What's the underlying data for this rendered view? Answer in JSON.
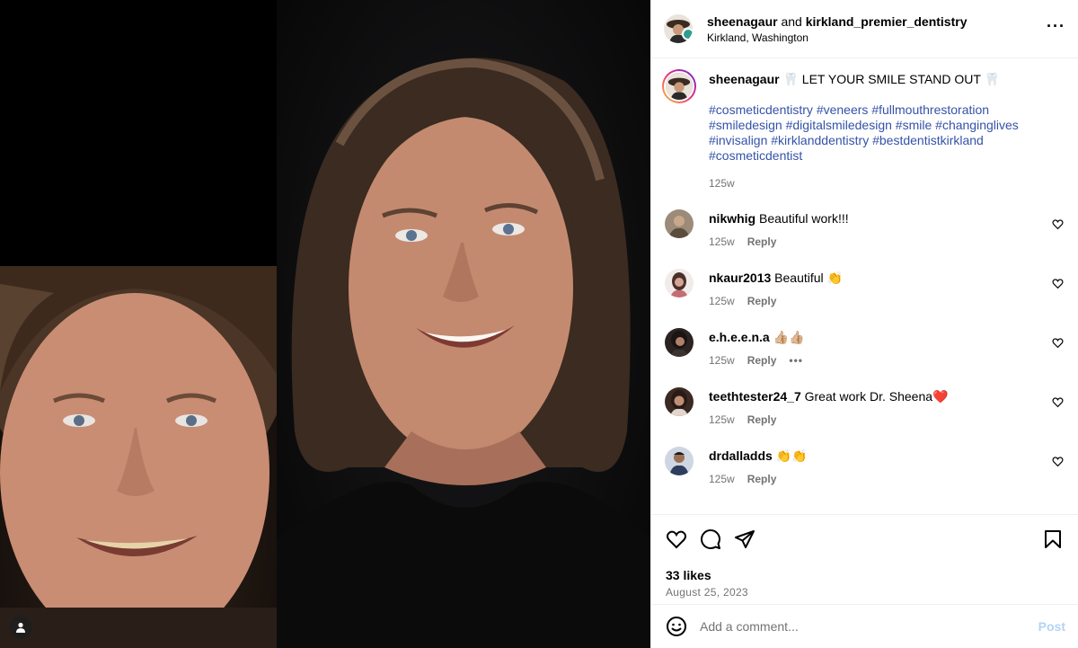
{
  "header": {
    "username": "sheenagaur",
    "conjunction": "and",
    "collaborator": "kirkland_premier_dentistry",
    "location": "Kirkland, Washington",
    "more_icon": "more-horizontal-icon"
  },
  "caption": {
    "username": "sheenagaur",
    "text": "🦷 LET YOUR SMILE STAND OUT 🦷",
    "hashtags": [
      "#cosmeticdentistry",
      "#veneers",
      "#fullmouthrestoration",
      "#smiledesign",
      "#digitalsmiledesign",
      "#smile",
      "#changinglives",
      "#invisalign",
      "#kirklanddentistry",
      "#bestdentistkirkland",
      "#cosmeticdentist"
    ],
    "time": "125w"
  },
  "comments": [
    {
      "username": "nikwhig",
      "text": "Beautiful work!!!",
      "time": "125w",
      "reply": "Reply",
      "avatar_color": "#7a6a55"
    },
    {
      "username": "nkaur2013",
      "text": "Beautiful 👏",
      "time": "125w",
      "reply": "Reply",
      "avatar_color": "#c9a6a0"
    },
    {
      "username": "e.h.e.e.n.a",
      "text": "👍🏼👍🏼",
      "time": "125w",
      "reply": "Reply",
      "more": "•••",
      "avatar_color": "#3a2e2a"
    },
    {
      "username": "teethtester24_7",
      "text": "Great work Dr. Sheena❤️",
      "time": "125w",
      "reply": "Reply",
      "avatar_color": "#5a3b30"
    },
    {
      "username": "drdalladds",
      "text": "👏👏",
      "time": "125w",
      "reply": "Reply",
      "avatar_color": "#3b4a66"
    }
  ],
  "actions": {
    "like_icon": "heart-icon",
    "comment_icon": "comment-icon",
    "share_icon": "send-icon",
    "save_icon": "bookmark-icon"
  },
  "likes": "33 likes",
  "date": "August 25, 2023",
  "add_comment": {
    "placeholder": "Add a comment...",
    "post_label": "Post",
    "emoji_icon": "emoji-icon"
  },
  "colors": {
    "hashtag": "#3552a8",
    "muted": "#737373",
    "post_disabled": "#b3d3f7",
    "border": "#efefef"
  }
}
